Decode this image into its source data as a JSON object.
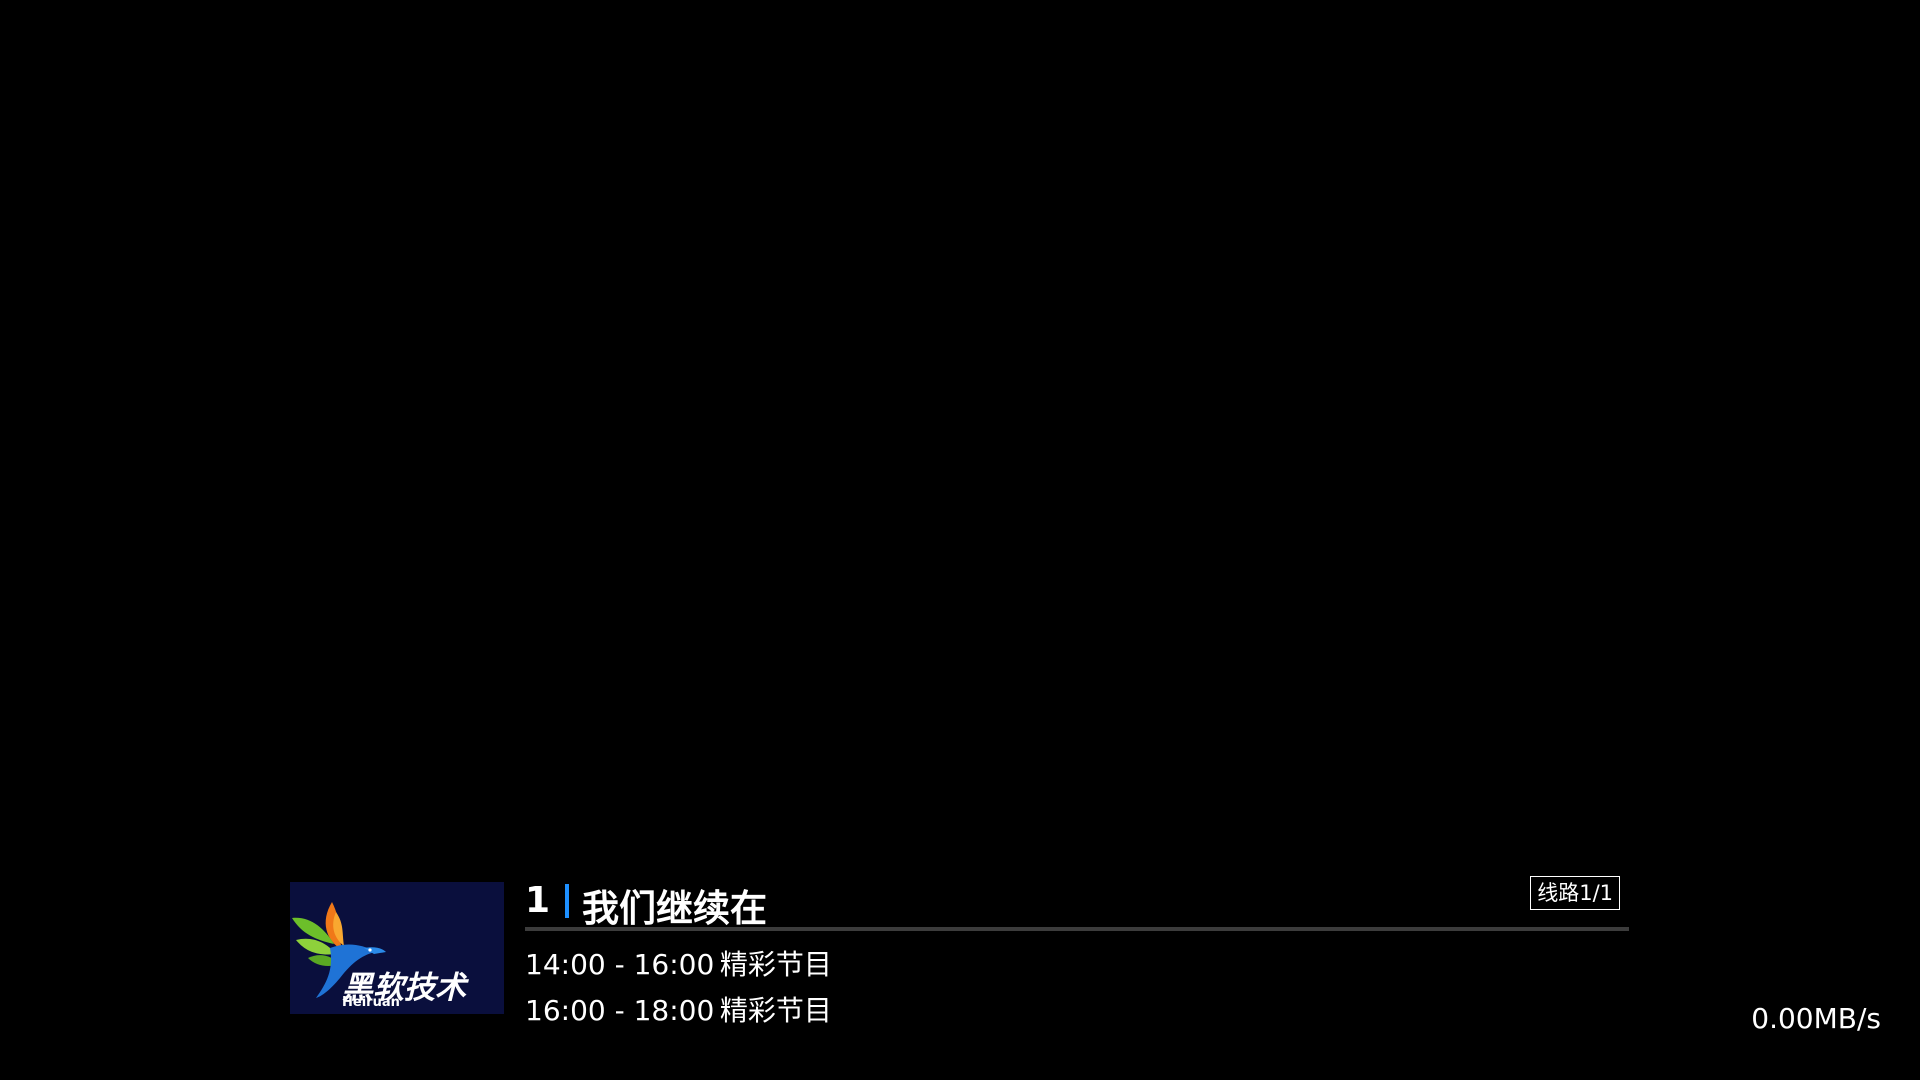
{
  "channel": {
    "number": "1",
    "name": "我们继续在",
    "route": "线路1/1",
    "progress": 0,
    "logo": {
      "text": "黑软技术",
      "subtext": "Heiruan"
    }
  },
  "epg": [
    {
      "time": "14:00 - 16:00",
      "title": "精彩节目"
    },
    {
      "time": "16:00 - 18:00",
      "title": "精彩节目"
    }
  ],
  "status": {
    "speed": "0.00MB/s"
  },
  "colors": {
    "background": "#000000",
    "accent": "#1e90ff",
    "text": "#ffffff",
    "logo_background": "#0a0f3d"
  }
}
